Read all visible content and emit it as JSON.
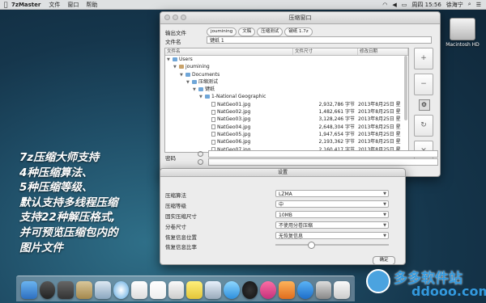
{
  "menubar": {
    "app": "7zMaster",
    "items": [
      "文件",
      "窗口",
      "帮助"
    ],
    "clock": "周四 15:56",
    "user": "徐海宁"
  },
  "desktop": {
    "hd_label": "Macintosh HD"
  },
  "main_window": {
    "title": "压缩窗口",
    "output_label": "输出文件",
    "breadcrumbs": [
      "joumining",
      "文稿",
      "压缩测试",
      "键纸 1.7z"
    ],
    "filename_label": "文件名",
    "filename_value": "键纸 1",
    "columns": [
      "文件名",
      "文件尺寸",
      "修改日期"
    ],
    "rows": [
      {
        "indent": 0,
        "kind": "folder",
        "name": "Users",
        "size": "",
        "date": ""
      },
      {
        "indent": 1,
        "kind": "home",
        "name": "joumining",
        "size": "",
        "date": ""
      },
      {
        "indent": 2,
        "kind": "folder",
        "name": "Documents",
        "size": "",
        "date": ""
      },
      {
        "indent": 3,
        "kind": "folder",
        "name": "压缩测试",
        "size": "",
        "date": ""
      },
      {
        "indent": 4,
        "kind": "folder",
        "name": "键纸",
        "size": "",
        "date": ""
      },
      {
        "indent": 5,
        "kind": "folder",
        "name": "1-National Geographic",
        "size": "",
        "date": ""
      },
      {
        "indent": 6,
        "kind": "image",
        "name": "NatGeo01.jpg",
        "size": "2,932,786 字节",
        "date": "2013年8月25日 星"
      },
      {
        "indent": 6,
        "kind": "image",
        "name": "NatGeo02.jpg",
        "size": "1,482,661 字节",
        "date": "2013年8月25日 星"
      },
      {
        "indent": 6,
        "kind": "image",
        "name": "NatGeo03.jpg",
        "size": "3,128,246 字节",
        "date": "2013年8月25日 星"
      },
      {
        "indent": 6,
        "kind": "image",
        "name": "NatGeo04.jpg",
        "size": "2,648,304 字节",
        "date": "2013年8月25日 星"
      },
      {
        "indent": 6,
        "kind": "image",
        "name": "NatGeo05.jpg",
        "size": "1,947,654 字节",
        "date": "2013年8月25日 星"
      },
      {
        "indent": 6,
        "kind": "image",
        "name": "NatGeo06.jpg",
        "size": "2,193,362 字节",
        "date": "2013年8月25日 星"
      },
      {
        "indent": 6,
        "kind": "image",
        "name": "NatGeo07.jpg",
        "size": "2,160,417 字节",
        "date": "2013年8月25日 星"
      }
    ],
    "side_buttons": [
      "+",
      "−",
      "⚙",
      "↻",
      "✕"
    ],
    "password_label": "密码"
  },
  "settings_window": {
    "title": "设置",
    "rows": [
      {
        "label": "压缩算法",
        "value": "LZMA"
      },
      {
        "label": "压缩等级",
        "value": "中"
      },
      {
        "label": "固实压缩尺寸",
        "value": "10MB"
      },
      {
        "label": "分卷尺寸",
        "value": "不使用分卷压缩"
      },
      {
        "label": "恢复信息位置",
        "value": "无恢复信息"
      }
    ],
    "recovery_ratio_label": "恢复信息比率",
    "ok_label": "确定"
  },
  "overlay_lines": [
    "7z压缩大师支持",
    "4种压缩算法、",
    "5种压缩等级、",
    "默认支持多线程压缩",
    "支持22种解压格式,",
    "并可预览压缩包内的",
    "图片文件"
  ],
  "watermark": {
    "cn": "多多软件站",
    "en": "ddooo.com"
  }
}
